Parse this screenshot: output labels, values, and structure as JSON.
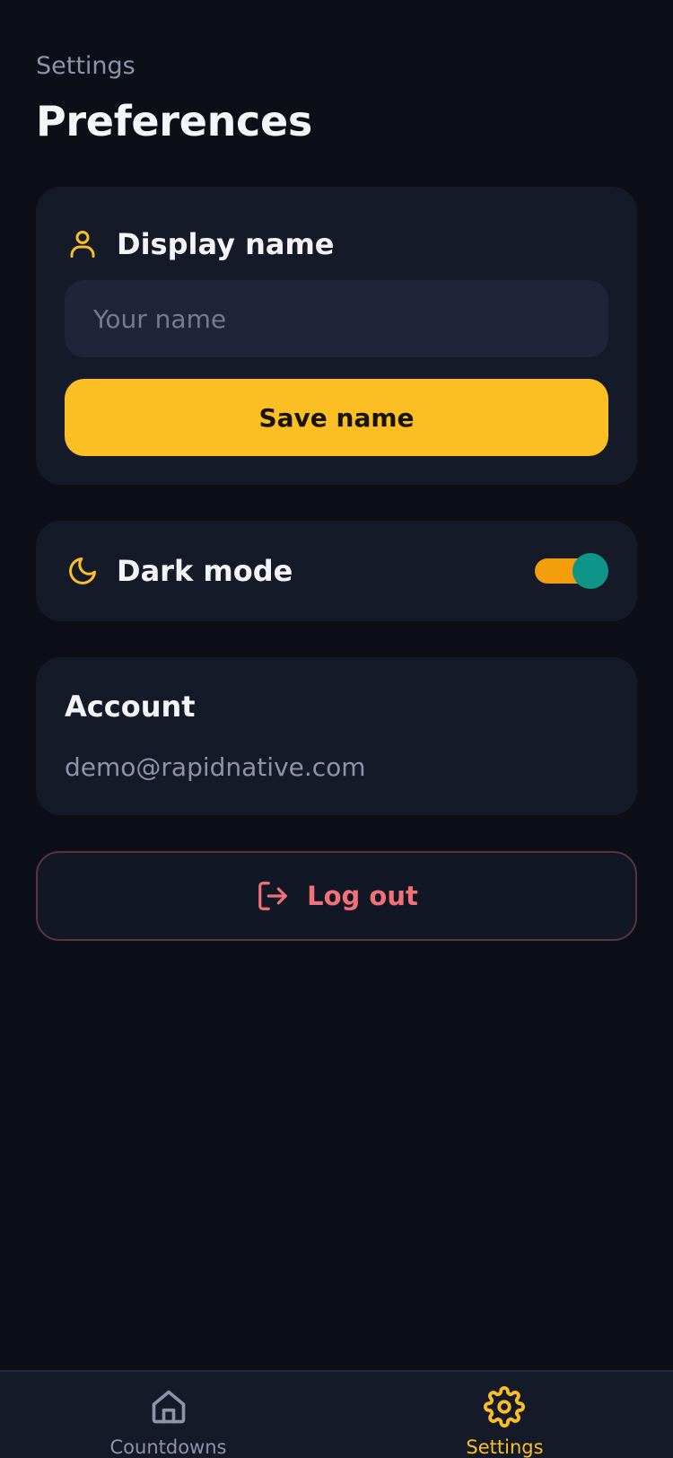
{
  "header": {
    "subtitle": "Settings",
    "title": "Preferences"
  },
  "display_name": {
    "title": "Display name",
    "icon": "user-icon",
    "input_value": "",
    "input_placeholder": "Your name",
    "save_label": "Save name"
  },
  "dark_mode": {
    "title": "Dark mode",
    "icon": "moon-icon",
    "enabled": true
  },
  "account": {
    "title": "Account",
    "email": "demo@rapidnative.com"
  },
  "logout": {
    "label": "Log out",
    "icon": "log-out-icon"
  },
  "tabbar": {
    "tabs": [
      {
        "label": "Countdowns",
        "icon": "home-icon",
        "active": false
      },
      {
        "label": "Settings",
        "icon": "gear-icon",
        "active": true
      }
    ]
  },
  "colors": {
    "background": "#0c0e18",
    "card": "#151a29",
    "accent": "#fbbf24",
    "toggle_track": "#f59e0b",
    "toggle_thumb": "#0f9488",
    "danger": "#f07178",
    "muted": "#8e93a8"
  }
}
